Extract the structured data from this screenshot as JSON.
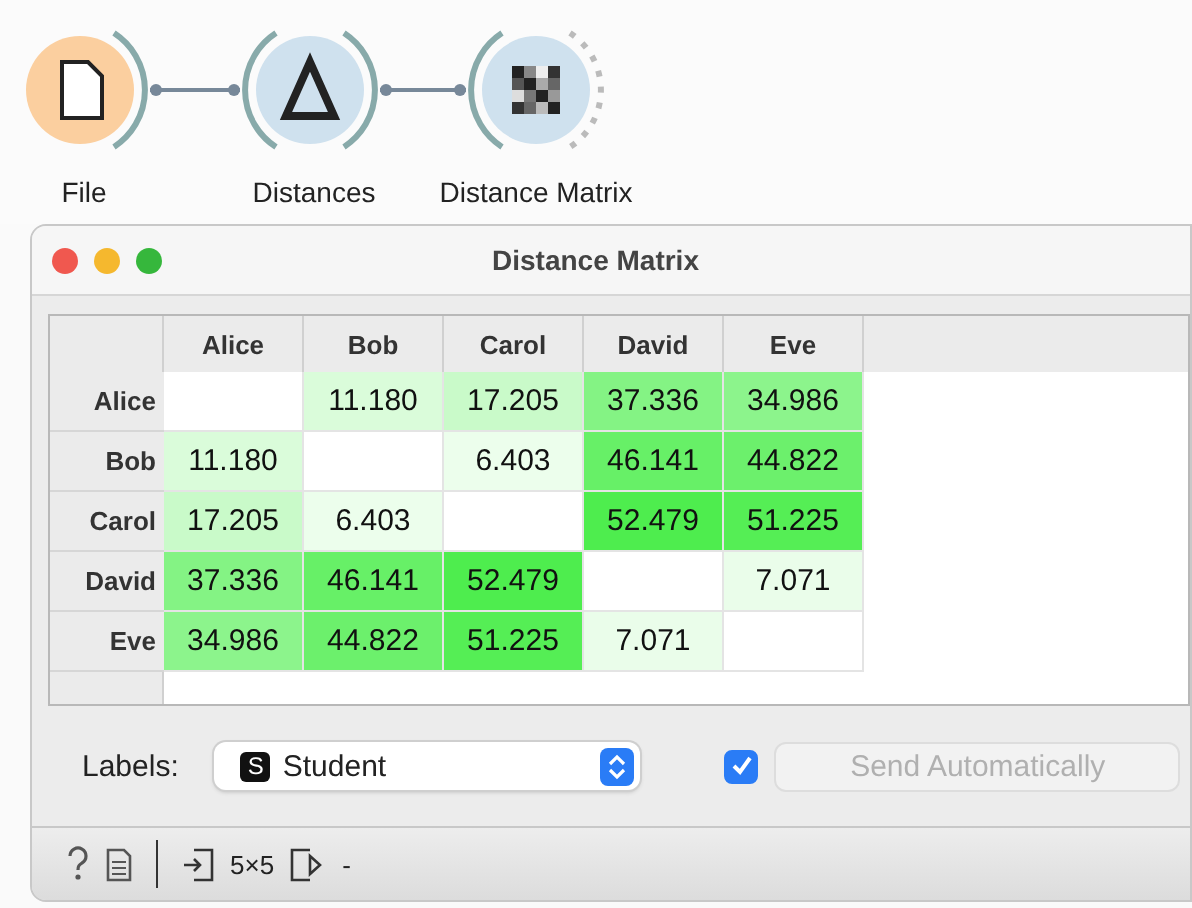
{
  "workflow": {
    "nodes": [
      {
        "label": "File",
        "kind": "file"
      },
      {
        "label": "Distances",
        "kind": "distances"
      },
      {
        "label": "Distance Matrix",
        "kind": "matrix"
      }
    ]
  },
  "window": {
    "title": "Distance Matrix"
  },
  "matrix": {
    "columns": [
      "Alice",
      "Bob",
      "Carol",
      "David",
      "Eve"
    ],
    "rows": [
      {
        "label": "Alice",
        "cells": [
          {
            "color": "#ffffff"
          },
          {
            "text": "11.180",
            "color": "#dafcda"
          },
          {
            "text": "17.205",
            "color": "#c9fac9"
          },
          {
            "text": "37.336",
            "color": "#84f384"
          },
          {
            "text": "34.986",
            "color": "#8cf48c"
          }
        ]
      },
      {
        "label": "Bob",
        "cells": [
          {
            "text": "11.180",
            "color": "#dafcda"
          },
          {
            "color": "#ffffff"
          },
          {
            "text": "6.403",
            "color": "#ecfeec"
          },
          {
            "text": "46.141",
            "color": "#67f067"
          },
          {
            "text": "44.822",
            "color": "#6cf06c"
          }
        ]
      },
      {
        "label": "Carol",
        "cells": [
          {
            "text": "17.205",
            "color": "#c9fac9"
          },
          {
            "text": "6.403",
            "color": "#ecfeec"
          },
          {
            "color": "#ffffff"
          },
          {
            "text": "52.479",
            "color": "#4eed4e"
          },
          {
            "text": "51.225",
            "color": "#55ee55"
          }
        ]
      },
      {
        "label": "David",
        "cells": [
          {
            "text": "37.336",
            "color": "#84f384"
          },
          {
            "text": "46.141",
            "color": "#67f067"
          },
          {
            "text": "52.479",
            "color": "#4eed4e"
          },
          {
            "color": "#ffffff"
          },
          {
            "text": "7.071",
            "color": "#eafdea"
          }
        ]
      },
      {
        "label": "Eve",
        "cells": [
          {
            "text": "34.986",
            "color": "#8cf48c"
          },
          {
            "text": "44.822",
            "color": "#6cf06c"
          },
          {
            "text": "51.225",
            "color": "#55ee55"
          },
          {
            "text": "7.071",
            "color": "#eafdea"
          },
          {
            "color": "#ffffff"
          }
        ]
      }
    ]
  },
  "labels": {
    "label": "Labels:",
    "badge": "S",
    "value": "Student"
  },
  "send": {
    "checked": true,
    "label": "Send Automatically",
    "disabled": true
  },
  "status_bar": {
    "input": "5×5",
    "output": "-"
  }
}
